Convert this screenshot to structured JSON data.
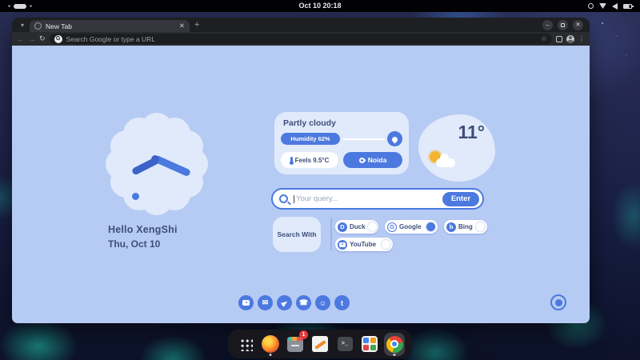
{
  "colors": {
    "accent": "#4c79df",
    "accent_dark": "#3c63c8",
    "page_bg": "#b6cbf4",
    "card_bg": "#e0eafb",
    "navy": "#3e4e7a"
  },
  "topbar": {
    "clock": "Oct 10 20:18"
  },
  "browser": {
    "tab_title": "New Tab",
    "omnibox_placeholder": "Search Google or type a URL",
    "google_badge": "G"
  },
  "page": {
    "greeting": "Hello XengShi",
    "date": "Thu, Oct 10",
    "weather": {
      "condition": "Partly cloudy",
      "humidity": "Humidity 62%",
      "feels": "Feels 9.5°C",
      "location": "Noida",
      "temperature": "11°"
    },
    "search": {
      "placeholder": "Your query...",
      "enter": "Enter",
      "with_label": "Search With",
      "engines": [
        {
          "label": "Duck",
          "selected": false
        },
        {
          "label": "Google",
          "selected": true
        },
        {
          "label": "Bing",
          "selected": false
        },
        {
          "label": "YouTube",
          "selected": false
        }
      ]
    },
    "socials": [
      "youtube",
      "mail",
      "telegram",
      "whatsapp",
      "reddit",
      "twitter"
    ]
  },
  "icons": {
    "duck": "D",
    "google": "G",
    "bing": "b",
    "mail": "✉",
    "whatsapp": "☎",
    "reddit": "☺",
    "twitter": "t"
  },
  "dock": {
    "badge": "1",
    "apps": [
      "app-grid",
      "firefox",
      "software-updates",
      "text-editor",
      "terminal",
      "app-store",
      "chrome"
    ]
  }
}
